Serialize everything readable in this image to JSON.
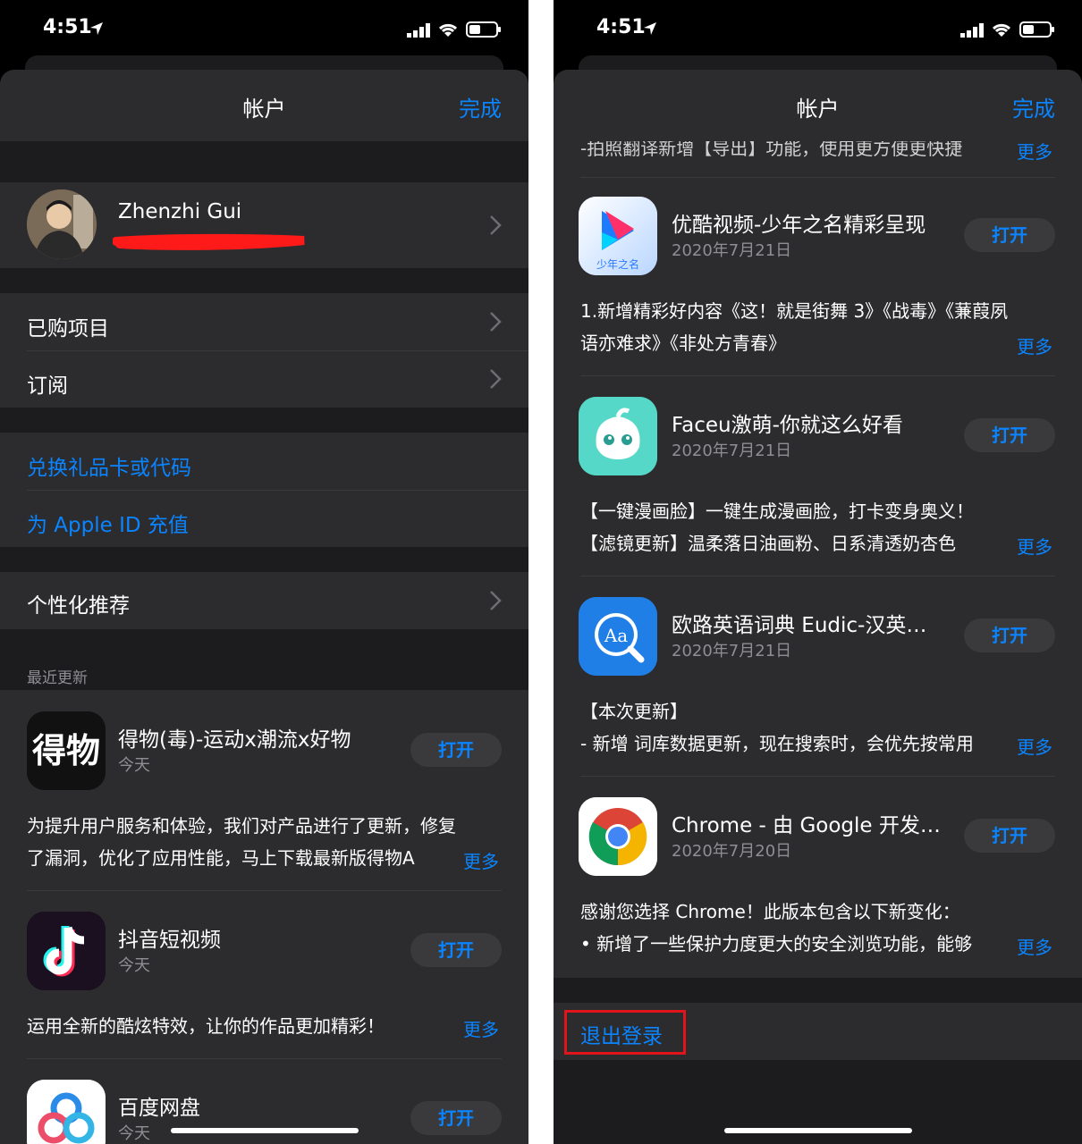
{
  "status": {
    "time": "4:51"
  },
  "nav": {
    "title": "帐户",
    "done": "完成"
  },
  "profile": {
    "name": "Zhenzhi Gui"
  },
  "menu": {
    "purchased": "已购项目",
    "subscriptions": "订阅",
    "redeem": "兑换礼品卡或代码",
    "add_funds": "为 Apple ID 充值",
    "personalized": "个性化推荐"
  },
  "recent_updates_header": "最近更新",
  "open_label": "打开",
  "more_label": "更多",
  "left_apps": [
    {
      "name": "得物(毒)-运动x潮流x好物",
      "date": "今天",
      "note1": "为提升用户服务和体验，我们对产品进行了更新，修复",
      "note2": "了漏洞，优化了应用性能，马上下载最新版得物A",
      "icon": "dewu-icon"
    },
    {
      "name": "抖音短视频",
      "date": "今天",
      "note1": "运用全新的酷炫特效，让你的作品更加精彩！",
      "note2": "",
      "icon": "douyin-icon"
    },
    {
      "name": "百度网盘",
      "date": "今天",
      "icon": "baidu-netdisk-icon"
    }
  ],
  "right_top_note": "-拍照翻译新增【导出】功能，使用更方便更快捷",
  "right_apps": [
    {
      "name": "优酷视频-少年之名精彩呈现",
      "date": "2020年7月21日",
      "note1": "1.新增精彩好内容《这！就是街舞 3》《战毒》《蒹葭夙",
      "note2": "语亦难求》《非处方青春》",
      "icon": "youku-icon"
    },
    {
      "name": "Faceu激萌-你就这么好看",
      "date": "2020年7月21日",
      "note1": "【一键漫画脸】一键生成漫画脸，打卡变身奥义！",
      "note2": "【滤镜更新】温柔落日油画粉、日系清透奶杏色",
      "icon": "faceu-icon"
    },
    {
      "name": "欧路英语词典 Eudic-汉英…",
      "date": "2020年7月21日",
      "note1": "【本次更新】",
      "note2": "- 新增 词库数据更新，现在搜索时，会优先按常用",
      "icon": "eudic-icon"
    },
    {
      "name": "Chrome - 由 Google 开发…",
      "date": "2020年7月20日",
      "note1": "感谢您选择 Chrome！此版本包含以下新变化：",
      "note2": "• 新增了一些保护力度更大的安全浏览功能，能够",
      "icon": "chrome-icon"
    }
  ],
  "sign_out": "退出登录",
  "colors": {
    "accent": "#0a84ff",
    "background": "#1c1c1e",
    "cell": "#2c2c2e",
    "highlight": "#e0141a"
  }
}
